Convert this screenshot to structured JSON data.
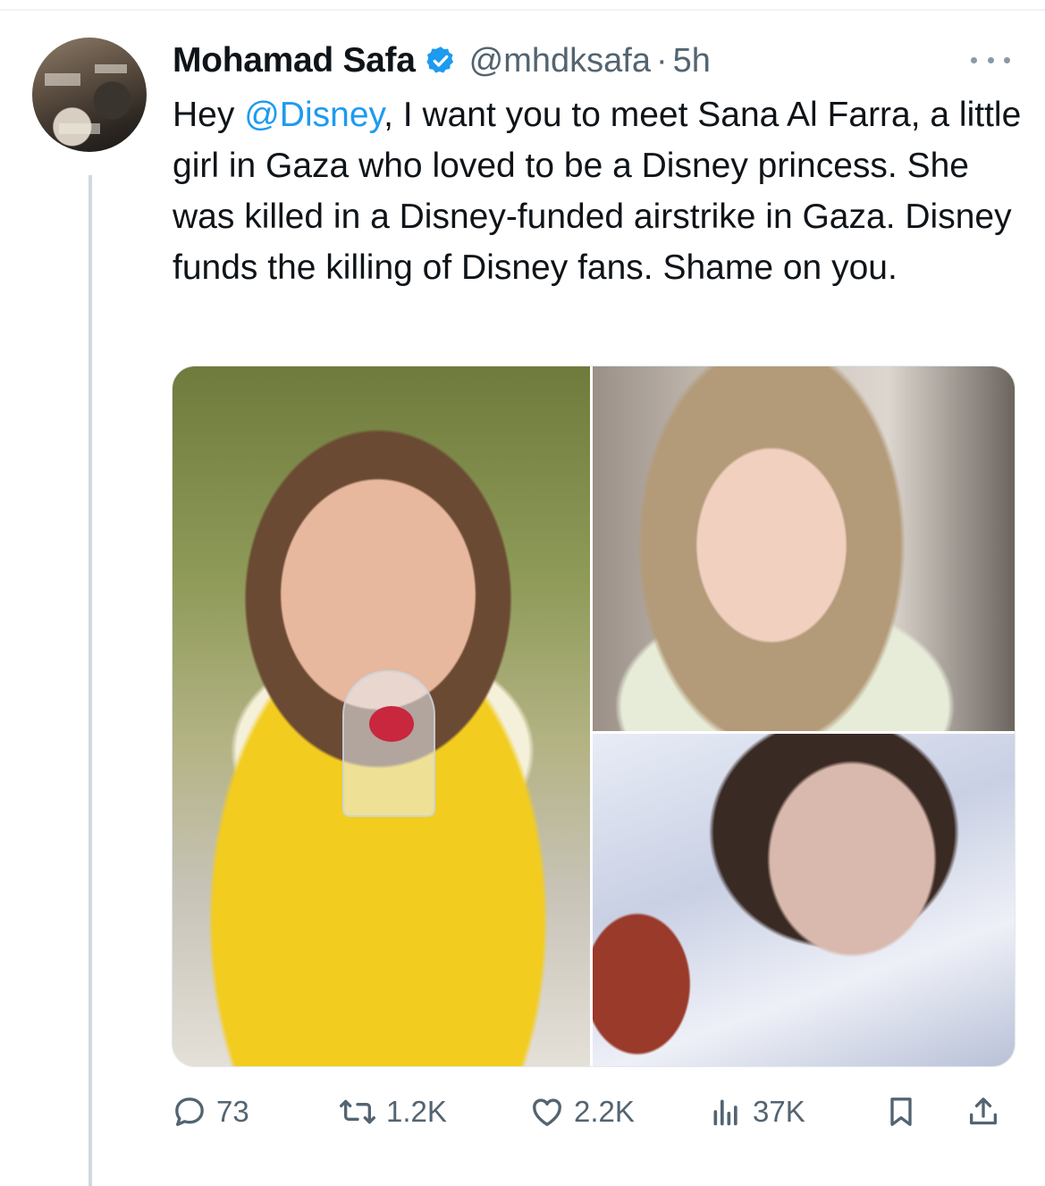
{
  "tweet": {
    "author_name": "Mohamad Safa",
    "handle": "@mhdksafa",
    "separator": "·",
    "time": "5h",
    "verified_icon": "verified-badge-icon",
    "text_before_mention": "Hey ",
    "mention": "@Disney",
    "text_after_mention": ", I want you to meet Sana Al Farra, a little girl in Gaza who loved to be a Disney princess. She was killed in a Disney-funded airstrike in Gaza. Disney funds the killing of Disney fans. Shame on you."
  },
  "actions": {
    "replies": "73",
    "reposts": "1.2K",
    "likes": "2.2K",
    "views": "37K",
    "icons": [
      "reply-icon",
      "repost-icon",
      "like-icon",
      "views-icon",
      "bookmark-icon",
      "share-icon"
    ]
  },
  "colors": {
    "text": "#0f1419",
    "secondary": "#536471",
    "link": "#1d9bf0",
    "thread_line": "#cfd9de"
  }
}
